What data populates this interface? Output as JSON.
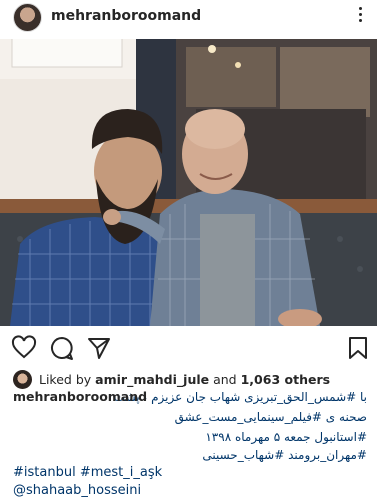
{
  "post": {
    "username": "mehranboroomand",
    "icons": {
      "more": "more-vertical-icon",
      "like": "heart-icon",
      "comment": "comment-icon",
      "share": "send-icon",
      "save": "bookmark-icon"
    }
  },
  "likes": {
    "prefix": "Liked by",
    "user": "amir_mahdi_jule",
    "conj": "and",
    "count": "1,063 others"
  },
  "caption": {
    "author": "mehranboroomand",
    "line1_rest": "با #شمس_الحق_تبریزی شهاب جان عزیزم ، پشت",
    "line2": "صحنه ی #فیلم_سینمایی_مست_عشق",
    "line3": "#استانبول جمعه ۵ مهرماه ۱۳۹۸",
    "line4": "#مهران_برومند #شهاب_حسینی",
    "line5": "#istanbul #mest_i_aşk",
    "line6": "@shahaab_hosseini"
  },
  "colors": {
    "text": "#262626",
    "hashtag": "#003569"
  }
}
